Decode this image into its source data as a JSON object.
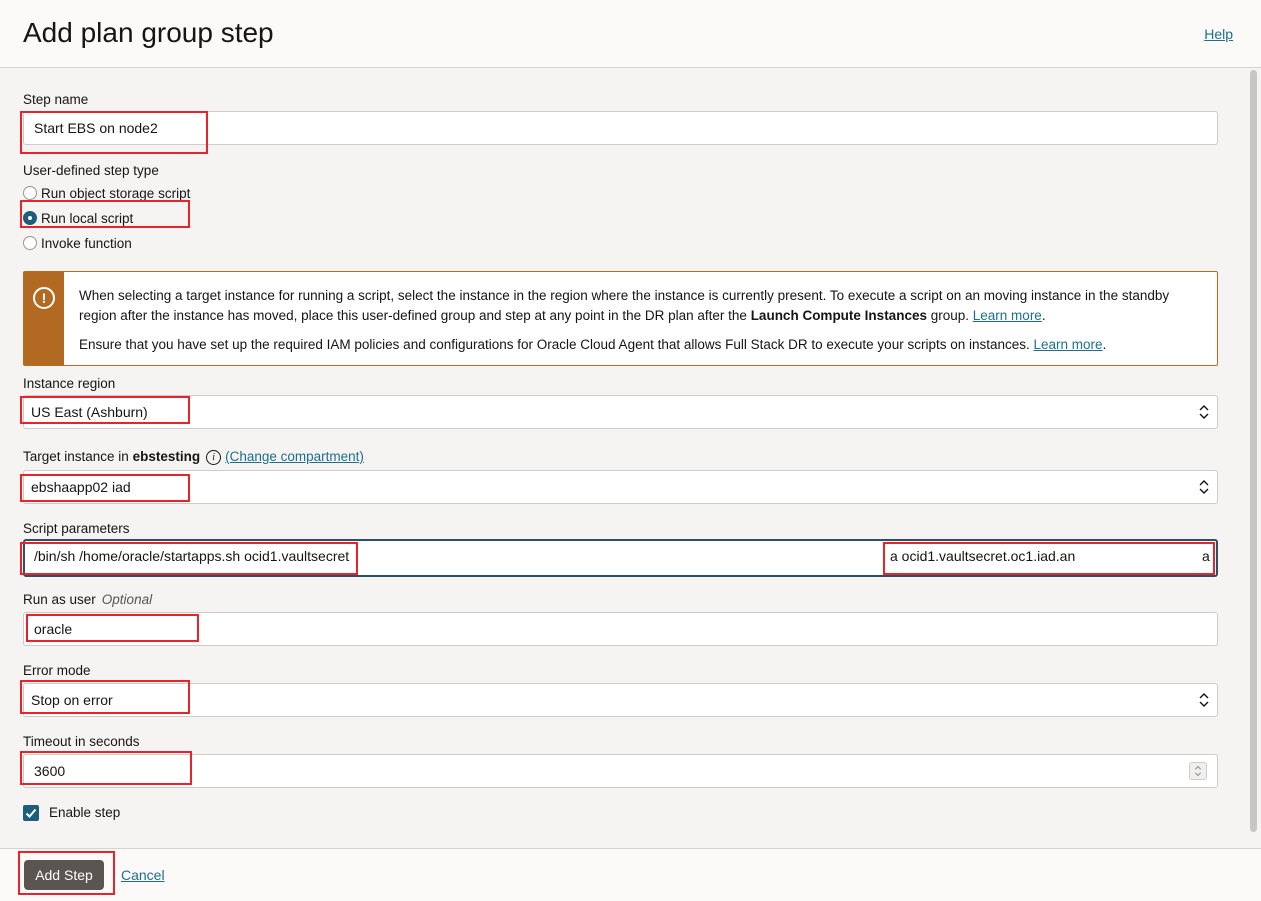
{
  "header": {
    "title": "Add plan group step",
    "help": "Help"
  },
  "step_name": {
    "label": "Step name",
    "value": "Start EBS on node2"
  },
  "step_type": {
    "label": "User-defined step type",
    "options": [
      "Run object storage script",
      "Run local script",
      "Invoke function"
    ],
    "selected": "Run local script"
  },
  "alert": {
    "p1_text": "When selecting a target instance for running a script, select the instance in the region where the instance is currently present. To execute a script on an moving instance in the standby region after the instance has moved, place this user-defined group and step at any point in the DR plan after the",
    "p1_bold": "Launch Compute Instances",
    "p1_after": "group.",
    "p2_text": "Ensure that you have set up the required IAM policies and configurations for Oracle Cloud Agent that allows Full Stack DR to execute your scripts on instances.",
    "learn_more": "Learn more",
    "period": "."
  },
  "instance_region": {
    "label": "Instance region",
    "value": "US East (Ashburn)"
  },
  "target_instance": {
    "label": "Target instance in",
    "compartment": "ebstesting",
    "change_link": "(Change compartment)",
    "value": "ebshaapp02 iad"
  },
  "script_parameters": {
    "label": "Script parameters",
    "value_part1": "/bin/sh /home/oracle/startapps.sh ocid1.vaultsecret",
    "value_part2": "a ocid1.vaultsecret.oc1.iad.an",
    "value_part3": "a"
  },
  "run_as_user": {
    "label": "Run as user",
    "optional": "Optional",
    "value": "oracle"
  },
  "error_mode": {
    "label": "Error mode",
    "value": "Stop on error"
  },
  "timeout": {
    "label": "Timeout in seconds",
    "value": "3600"
  },
  "enable_step": {
    "label": "Enable step",
    "checked": true
  },
  "footer": {
    "add_step": "Add Step",
    "cancel": "Cancel"
  }
}
